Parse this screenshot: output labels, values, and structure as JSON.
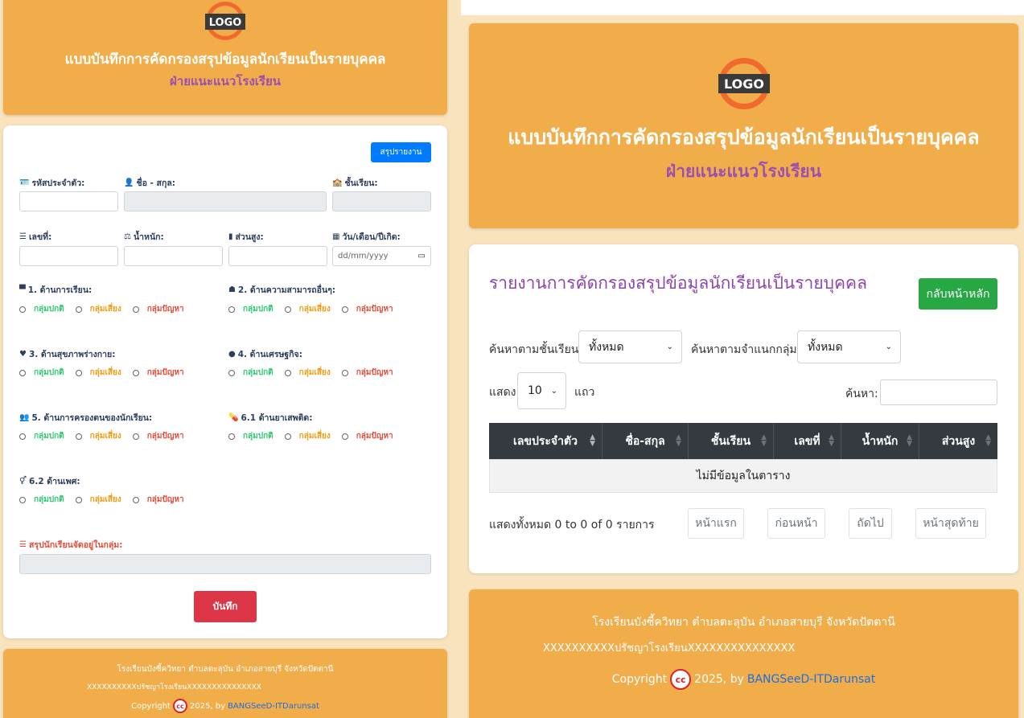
{
  "header": {
    "logo_text": "LOGO",
    "title": "แบบบันทึกการคัดกรองสรุปข้อมูลนักเรียนเป็นรายบุคคล",
    "subtitle": "ฝ่ายแนะแนวโรงเรียน"
  },
  "form": {
    "report_button": "สรุปรายงาน",
    "student_id_label": "รหัสประจำตัว:",
    "name_label": "ชื่อ - สกุล:",
    "class_label": "ชั้นเรียน:",
    "number_label": "เลขที่:",
    "weight_label": "น้ำหนัก:",
    "height_label": "ส่วนสูง:",
    "birthdate_label": "วัน/เดือน/ปีเกิด:",
    "birthdate_placeholder": "dd/mm/yyyy",
    "aspects": [
      {
        "label": "1. ด้านการเรียน:"
      },
      {
        "label": "2. ด้านความสามารถอื่นๆ:"
      },
      {
        "label": "3. ด้านสุขภาพร่างกาย:"
      },
      {
        "label": "4. ด้านเศรษฐกิจ:"
      },
      {
        "label": "5. ด้านการครองตนของนักเรียน:"
      },
      {
        "label": "6.1 ด้านยาเสพติด:"
      },
      {
        "label": "6.2 ด้านเพศ:"
      }
    ],
    "options": {
      "normal": "กลุ่มปกติ",
      "risk": "กลุ่มเสี่ยง",
      "problem": "กลุ่มปัญหา"
    },
    "summary_label": "สรุปนักเรียนจัดอยู่ในกลุ่ม:",
    "save_button": "บันทึก"
  },
  "footer": {
    "school": "โรงเรียนบังซี้ควิทยา ตำบลตะลุบัน อำเภอสายบุรี จังหวัดปัตตานี",
    "motto": "XXXXXXXXXXปรัชญาโรงเรียนXXXXXXXXXXXXXXX",
    "copyright_prefix": "Copyright",
    "copyright_year": "2025, by",
    "author": "BANGSeeD-ITDarunsat"
  },
  "report": {
    "title": "รายงานการคัดกรองสรุปข้อมูลนักเรียนเป็นรายบุคคล",
    "back_button": "กลับหน้าหลัก",
    "filter_class_label": "ค้นหาตามชั้นเรียน:",
    "filter_class_value": "ทั้งหมด",
    "filter_group_label": "ค้นหาตามจำแนกกลุ่ม:",
    "filter_group_value": "ทั้งหมด",
    "show_label": "แสดง",
    "show_value": "10",
    "rows_label": "แถว",
    "search_label": "ค้นหา:",
    "columns": [
      "เลขประจำตัว",
      "ชื่อ-สกุล",
      "ชั้นเรียน",
      "เลขที่",
      "น้ำหนัก",
      "ส่วนสูง"
    ],
    "empty_text": "ไม่มีข้อมูลในตาราง",
    "info_text": "แสดงทั้งหมด 0 to 0 of 0 รายการ",
    "pagination": [
      "หน้าแรก",
      "ก่อนหน้า",
      "ถัดไป",
      "หน้าสุดท้าย"
    ]
  },
  "colors": {
    "orange": "#f2ad4b",
    "purple": "#9b4fb0",
    "blue": "#007bff",
    "red": "#dc3545",
    "green": "#28a745",
    "dark": "#343a40"
  }
}
